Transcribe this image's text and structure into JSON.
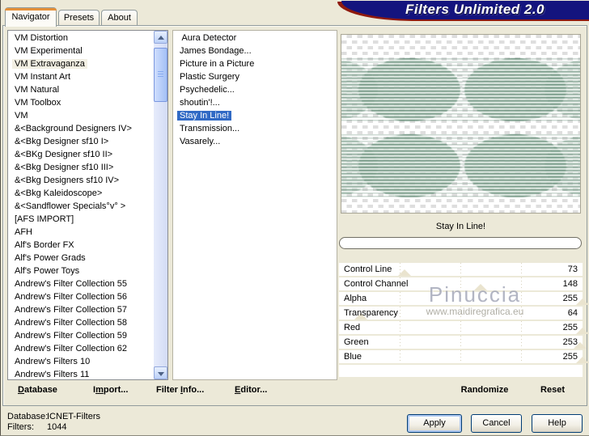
{
  "window": {
    "banner_title": "Filters Unlimited 2.0"
  },
  "tabs": {
    "items": [
      "Navigator",
      "Presets",
      "About"
    ],
    "active_index": 0
  },
  "left_list": {
    "selected_index": 2,
    "items": [
      "VM Distortion",
      "VM Experimental",
      "VM Extravaganza",
      "VM Instant Art",
      "VM Natural",
      "VM Toolbox",
      "VM",
      "&<Background Designers IV>",
      "&<Bkg Designer sf10 I>",
      "&<BKg Designer sf10 II>",
      "&<Bkg Designer sf10 III>",
      "&<Bkg Designers sf10 IV>",
      "&<Bkg Kaleidoscope>",
      "&<Sandflower Specials°v° >",
      "[AFS IMPORT]",
      "AFH",
      "Alf's Border FX",
      "Alf's Power Grads",
      "Alf's Power Toys",
      "Andrew's Filter Collection 55",
      "Andrew's Filter Collection 56",
      "Andrew's Filter Collection 57",
      "Andrew's Filter Collection 58",
      "Andrew's Filter Collection 59",
      "Andrew's Filter Collection 62",
      "Andrew's Filters 10",
      "Andrew's Filters 11"
    ]
  },
  "middle_list": {
    "selected_index": 6,
    "items": [
      " Aura Detector",
      "James Bondage...",
      "Picture in a Picture",
      "Plastic Surgery",
      "Psychedelic...",
      "shoutin'!...",
      "Stay In Line!",
      "Transmission...",
      "Vasarely..."
    ]
  },
  "preview": {
    "filter_title": "Stay In Line!"
  },
  "parameters": {
    "max": 255,
    "rows": [
      {
        "name": "Control Line",
        "value": 73,
        "thumb_pct": 27
      },
      {
        "name": "Control Channel",
        "value": 148,
        "thumb_pct": 58
      },
      {
        "name": "Alpha",
        "value": 255,
        "thumb_pct": 100
      },
      {
        "name": "Transparency",
        "value": 64,
        "thumb_pct": 9
      },
      {
        "name": "Red",
        "value": 255,
        "thumb_pct": 100
      },
      {
        "name": "Green",
        "value": 253,
        "thumb_pct": 99
      },
      {
        "name": "Blue",
        "value": 255,
        "thumb_pct": 100
      }
    ]
  },
  "watermark": {
    "line1": "Pinuccia",
    "line2": "www.maidiregrafica.eu"
  },
  "actions": {
    "randomize": "Randomize",
    "reset": "Reset"
  },
  "toolbar": {
    "items": [
      {
        "pre": "",
        "accel": "D",
        "post": "atabase"
      },
      {
        "pre": "I",
        "accel": "m",
        "post": "port..."
      },
      {
        "pre": "Filter ",
        "accel": "I",
        "post": "nfo..."
      },
      {
        "pre": "",
        "accel": "E",
        "post": "ditor..."
      }
    ]
  },
  "status": {
    "database_label": "Database:",
    "database_value": "ICNET-Filters",
    "filters_label": "Filters:",
    "filters_value": "1044"
  },
  "buttons": {
    "apply": "Apply",
    "cancel": "Cancel",
    "help": "Help"
  },
  "colors": {
    "dialog_bg": "#ECE9D8",
    "banner_navy": "#14147E",
    "banner_edge": "#8F1A0E",
    "selection_blue": "#316AC5",
    "pale_selection": "#F2EFE3",
    "preview_green": "#4E7B63"
  }
}
